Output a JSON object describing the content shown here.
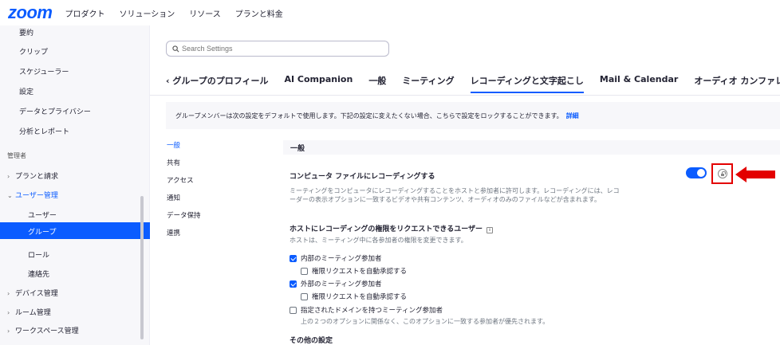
{
  "topnav": {
    "logo": "zoom",
    "items": [
      "プロダクト",
      "ソリューション",
      "リソース",
      "プランと料金"
    ]
  },
  "sidebar": {
    "items": [
      {
        "label": "要約",
        "level": "item"
      },
      {
        "label": "クリップ",
        "level": "item"
      },
      {
        "label": "スケジューラー",
        "level": "item"
      },
      {
        "label": "設定",
        "level": "item"
      },
      {
        "label": "データとプライバシー",
        "level": "item"
      },
      {
        "label": "分析とレポート",
        "level": "item"
      },
      {
        "label": "管理者",
        "level": "section"
      },
      {
        "label": "プランと請求",
        "level": "group",
        "chevron": "›"
      },
      {
        "label": "ユーザー管理",
        "level": "group",
        "chevron": "⌄"
      },
      {
        "label": "ユーザー",
        "level": "sub"
      },
      {
        "label": "グループ",
        "level": "sub",
        "active": true
      },
      {
        "label": "ロール",
        "level": "sub"
      },
      {
        "label": "連絡先",
        "level": "sub"
      },
      {
        "label": "デバイス管理",
        "level": "group",
        "chevron": "›"
      },
      {
        "label": "ルーム管理",
        "level": "group",
        "chevron": "›"
      },
      {
        "label": "ワークスペース管理",
        "level": "group",
        "chevron": "›"
      }
    ]
  },
  "search": {
    "placeholder": "Search Settings"
  },
  "tabs": [
    {
      "label": "‹  グループのプロフィール"
    },
    {
      "label": "AI Companion"
    },
    {
      "label": "一般"
    },
    {
      "label": "ミーティング"
    },
    {
      "label": "レコーディングと文字起こし",
      "active": true
    },
    {
      "label": "Mail & Calendar"
    },
    {
      "label": "オーディオ カンファレンス"
    }
  ],
  "notice": {
    "text": "グループメンバーは次の設定をデフォルトで使用します。下記の設定に変えたくない場合、こちらで設定をロックすることができます。",
    "link": "詳細"
  },
  "inner_nav": [
    "一般",
    "共有",
    "アクセス",
    "通知",
    "データ保持",
    "連携"
  ],
  "section": {
    "title": "一般"
  },
  "setting1": {
    "title": "コンピュータ ファイルにレコーディングする",
    "desc": "ミーティングをコンピュータにレコーディングすることをホストと参加者に許可します。レコーディングには、レコーダーの表示オプションに一致するビデオや共有コンテンツ、オーディオのみのファイルなどが含まれます。",
    "enabled": true
  },
  "setting2": {
    "title": "ホストにレコーディングの権限をリクエストできるユーザー",
    "desc": "ホストは、ミーティング中に各参加者の権限を変更できます。",
    "options": [
      {
        "label": "内部のミーティング参加者",
        "checked": true,
        "indent": 0
      },
      {
        "label": "権限リクエストを自動承認する",
        "checked": false,
        "indent": 1
      },
      {
        "label": "外部のミーティング参加者",
        "checked": true,
        "indent": 0
      },
      {
        "label": "権限リクエストを自動承認する",
        "checked": false,
        "indent": 1
      },
      {
        "label": "指定されたドメインを持つミーティング参加者",
        "checked": false,
        "indent": 0
      }
    ],
    "footnote": "上の２つのオプションに関係なく、このオプションに一致する参加者が優先されます。"
  },
  "other": {
    "title": "その他の設定"
  },
  "colors": {
    "accent": "#0b5cff",
    "highlight": "#e30000"
  }
}
